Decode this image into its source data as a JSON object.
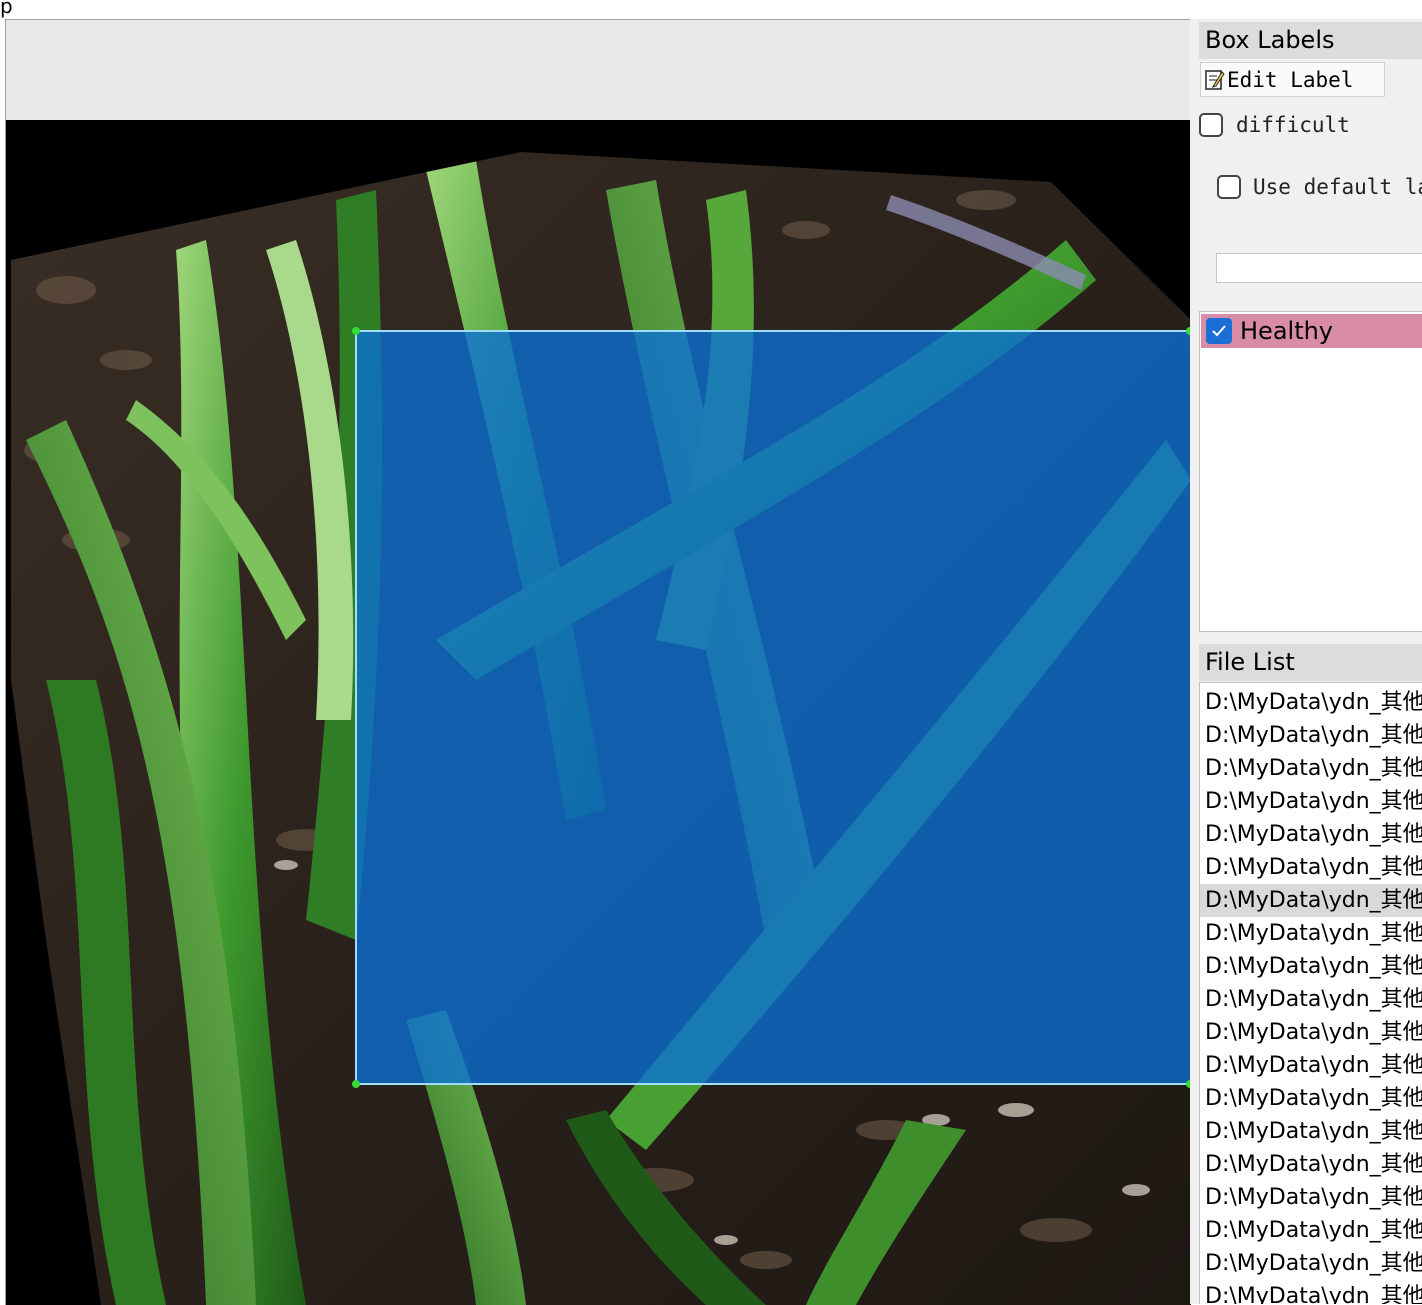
{
  "window": {
    "title_fragment": "p"
  },
  "dock": {
    "box_labels_title": "Box Labels",
    "edit_label_button": "Edit Label",
    "difficult_label": "difficult",
    "difficult_checked": false,
    "use_default_label": "Use default la",
    "use_default_checked": false,
    "default_label_value": "",
    "labels": [
      {
        "text": "Healthy",
        "checked": true,
        "color": "#d98ca8"
      }
    ],
    "file_list_title": "File List",
    "selected_file_index": 6,
    "files": [
      "D:\\MyData\\ydn_其他",
      "D:\\MyData\\ydn_其他",
      "D:\\MyData\\ydn_其他",
      "D:\\MyData\\ydn_其他",
      "D:\\MyData\\ydn_其他",
      "D:\\MyData\\ydn_其他",
      "D:\\MyData\\ydn_其他",
      "D:\\MyData\\ydn_其他",
      "D:\\MyData\\ydn_其他",
      "D:\\MyData\\ydn_其他",
      "D:\\MyData\\ydn_其他",
      "D:\\MyData\\ydn_其他",
      "D:\\MyData\\ydn_其他",
      "D:\\MyData\\ydn_其他",
      "D:\\MyData\\ydn_其他",
      "D:\\MyData\\ydn_其他",
      "D:\\MyData\\ydn_其他",
      "D:\\MyData\\ydn_其他",
      "D:\\MyData\\ydn_其他"
    ]
  },
  "canvas": {
    "box_fill": "#0a6fd6",
    "box_outline": "#9fdcff",
    "handle_color": "#33dd33"
  },
  "icons": {
    "edit": "edit-note-icon",
    "check": "checkmark-icon"
  }
}
